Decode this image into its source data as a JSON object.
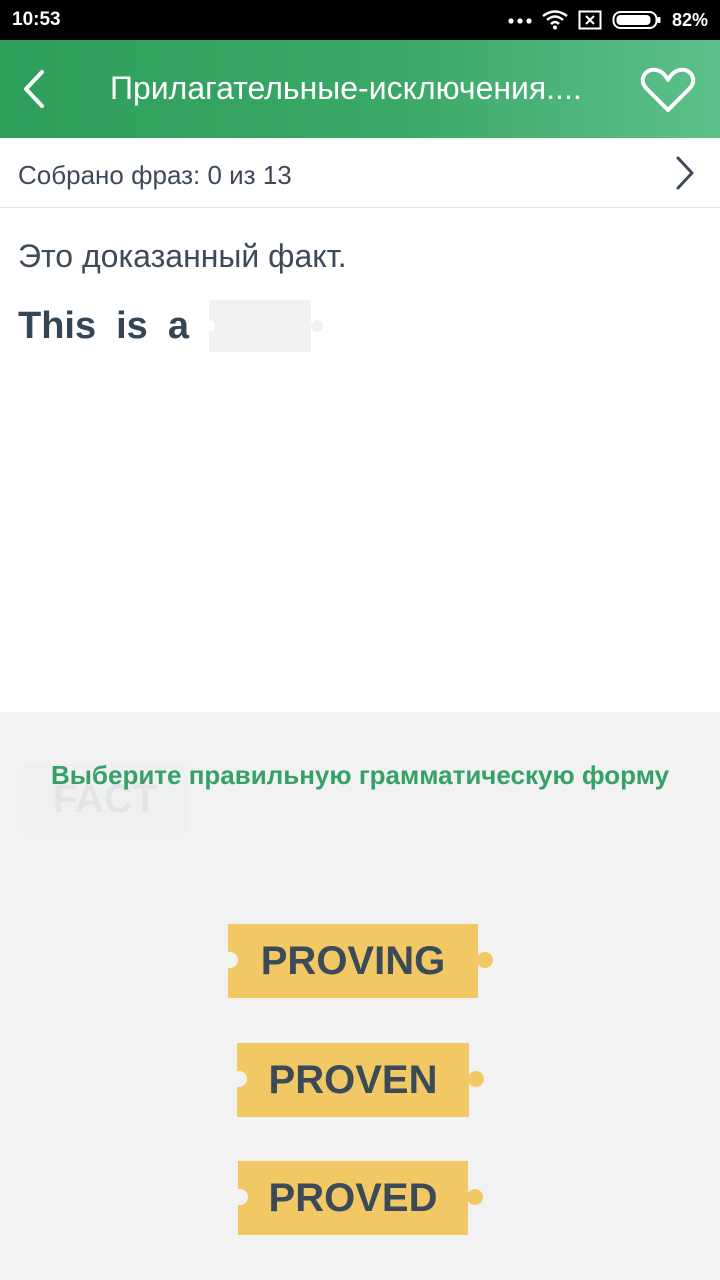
{
  "status_bar": {
    "time": "10:53",
    "battery_text": "82%",
    "icons": [
      "more-dots-icon",
      "wifi-icon",
      "no-sim-icon",
      "battery-icon"
    ]
  },
  "app_bar": {
    "title": "Прилагательные-исключения....",
    "back_icon": "back-arrow-icon",
    "favorite_icon": "heart-icon",
    "colors": {
      "start": "#2e9e5b",
      "end": "#5cc08a"
    }
  },
  "progress": {
    "text": "Собрано фраз: 0 из 13",
    "next_icon": "chevron-right-icon"
  },
  "exercise": {
    "russian_phrase": "Это доказанный факт.",
    "english_words": [
      "This",
      "is",
      "a"
    ],
    "ghost_word": "FACT"
  },
  "options_panel": {
    "instruction": "Выберите правильную грамматическую форму",
    "options": [
      "PROVING",
      "PROVEN",
      "PROVED"
    ],
    "colors": {
      "accent": "#35a165",
      "card": "#f2c864",
      "text": "#3b4a58"
    }
  }
}
